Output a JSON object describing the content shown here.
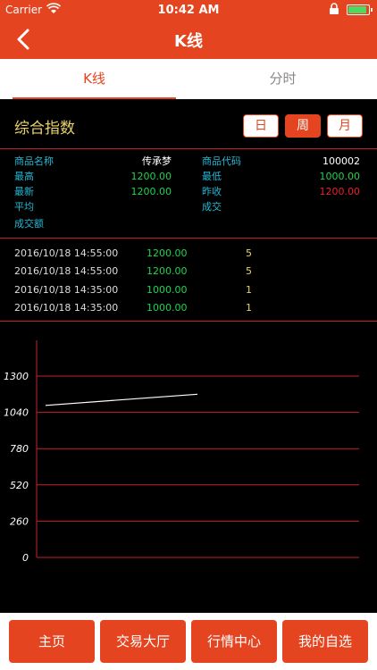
{
  "status_bar": {
    "carrier": "Carrier",
    "time": "10:42 AM"
  },
  "nav": {
    "title": "K线"
  },
  "tabs": [
    {
      "label": "K线",
      "active": true
    },
    {
      "label": "分时",
      "active": false
    }
  ],
  "section": {
    "name": "综合指数",
    "periods": [
      {
        "label": "日",
        "active": false
      },
      {
        "label": "周",
        "active": true
      },
      {
        "label": "月",
        "active": false
      }
    ]
  },
  "info": {
    "product_name_label": "商品名称",
    "product_name": "传承梦",
    "product_code_label": "商品代码",
    "product_code": "100002",
    "high_label": "最高",
    "high": "1200.00",
    "low_label": "最低",
    "low": "1000.00",
    "latest_label": "最新",
    "latest": "1200.00",
    "prev_close_label": "昨收",
    "prev_close": "1200.00",
    "average_label": "平均",
    "volume_label": "成交",
    "turnover_label": "成交额"
  },
  "trades": [
    {
      "time": "2016/10/18 14:55:00",
      "price": "1200.00",
      "qty": "5"
    },
    {
      "time": "2016/10/18 14:55:00",
      "price": "1200.00",
      "qty": "5"
    },
    {
      "time": "2016/10/18 14:35:00",
      "price": "1000.00",
      "qty": "1"
    },
    {
      "time": "2016/10/18 14:35:00",
      "price": "1000.00",
      "qty": "1"
    }
  ],
  "chart_data": {
    "type": "line",
    "y_ticks": [
      "1300",
      "1040",
      "780",
      "520",
      "260",
      "0"
    ],
    "ylim": [
      0,
      1300
    ],
    "grid": true,
    "series": [
      {
        "values": [
          1090,
          1170
        ]
      }
    ],
    "colors": {
      "grid": "#c8202a",
      "line": "#ffffff"
    }
  },
  "bottom_nav": [
    {
      "label": "主页"
    },
    {
      "label": "交易大厅"
    },
    {
      "label": "行情中心"
    },
    {
      "label": "我的自选"
    }
  ],
  "colors": {
    "accent": "#e4441f",
    "label": "#22b8d4",
    "up": "#1fd44c",
    "down": "#e4222a",
    "highlight": "#e7d267"
  }
}
